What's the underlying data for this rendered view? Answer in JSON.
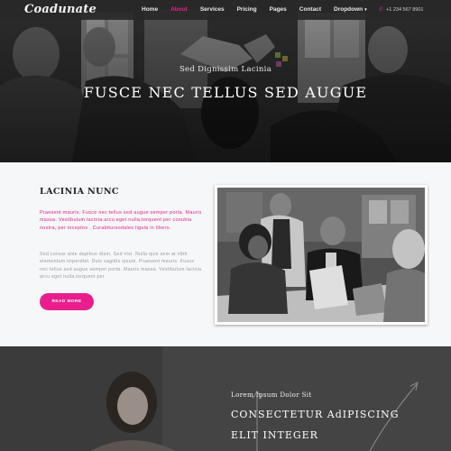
{
  "brand": {
    "logo": "Coadunate",
    "accent": "#e91e8c"
  },
  "nav": {
    "items": [
      {
        "label": "Home",
        "active": false
      },
      {
        "label": "About",
        "active": true
      },
      {
        "label": "Services",
        "active": false
      },
      {
        "label": "Pricing",
        "active": false
      },
      {
        "label": "Pages",
        "active": false
      },
      {
        "label": "Contact",
        "active": false
      },
      {
        "label": "Dropdown",
        "active": false
      }
    ],
    "phone": "+1 234 567 8901",
    "phone_icon": "phone-icon",
    "dropdown_icon": "caret-down-icon"
  },
  "hero": {
    "subtitle": "Sed Dignissim Lacinia",
    "title": "FUSCE NEC TELLUS SED AUGUE"
  },
  "about": {
    "heading": "LACINIA NUNC",
    "lead": "Praesent mauris. Fusce nec tellus sed augue semper porta. Mauris massa. Vestibulum lacinia arcu eget nulla.torquent per conubia nostra, per inceptos . Curabitursodales ligula in libero.",
    "body": "Sed cursus ante dapibus diam. Sed nisi. Nulla quis sem at nibh elementum imperdiet. Duis sagittis ipsum. Praesent mauris. Fusce nec tellus sed augue semper porta. Mauris massa. Vestibulum lacinia arcu eget nulla.torquent per",
    "button": "READ MORE"
  },
  "feature": {
    "kicker": "Lorem Ipsum Dolor Sit",
    "title_line1": "CONSECTETUR AdIPISCING",
    "title_line2": "ELIT INTEGER"
  }
}
